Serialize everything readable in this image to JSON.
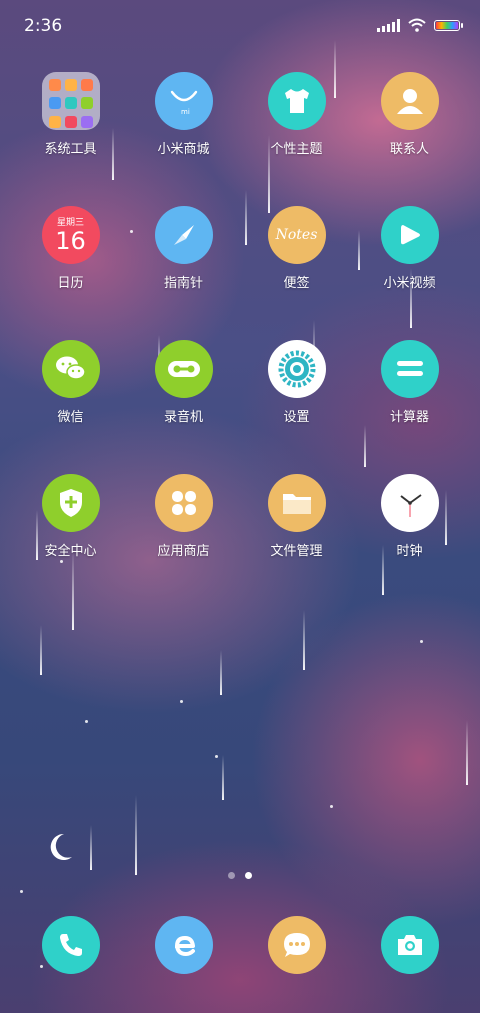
{
  "status_bar": {
    "time": "2:36"
  },
  "apps": [
    {
      "name": "系统工具",
      "icon": "folder-icon",
      "color": "#d8d0e4"
    },
    {
      "name": "小米商城",
      "icon": "shopping-bag-icon",
      "color": "#5fb6f2"
    },
    {
      "name": "个性主题",
      "icon": "tshirt-icon",
      "color": "#2fd1c9"
    },
    {
      "name": "联系人",
      "icon": "person-icon",
      "color": "#eebb66"
    },
    {
      "name": "日历",
      "icon": "calendar-icon",
      "color": "#f24a5f",
      "cal_weekday": "星期三",
      "cal_day": "16"
    },
    {
      "name": "指南针",
      "icon": "compass-icon",
      "color": "#5fb6f2"
    },
    {
      "name": "便签",
      "icon": "notes-icon",
      "color": "#eebb66",
      "notes_text": "Notes"
    },
    {
      "name": "小米视频",
      "icon": "play-icon",
      "color": "#2fd1c9"
    },
    {
      "name": "微信",
      "icon": "wechat-icon",
      "color": "#8fcf2c"
    },
    {
      "name": "录音机",
      "icon": "recorder-icon",
      "color": "#8fcf2c"
    },
    {
      "name": "设置",
      "icon": "gear-icon",
      "color": "#ffffff"
    },
    {
      "name": "计算器",
      "icon": "calculator-icon",
      "color": "#2fd1c9"
    },
    {
      "name": "安全中心",
      "icon": "shield-icon",
      "color": "#8fcf2c"
    },
    {
      "name": "应用商店",
      "icon": "apps-icon",
      "color": "#eebb66"
    },
    {
      "name": "文件管理",
      "icon": "folder-file-icon",
      "color": "#eebb66"
    },
    {
      "name": "时钟",
      "icon": "clock-icon",
      "color": "#ffffff"
    }
  ],
  "dock": [
    {
      "icon": "phone-icon",
      "color": "#2fd1c9"
    },
    {
      "icon": "browser-icon",
      "color": "#5fb6f2"
    },
    {
      "icon": "messages-icon",
      "color": "#eebb66"
    },
    {
      "icon": "camera-icon",
      "color": "#2fd1c9"
    }
  ],
  "pages": {
    "count": 2,
    "active": 1
  }
}
